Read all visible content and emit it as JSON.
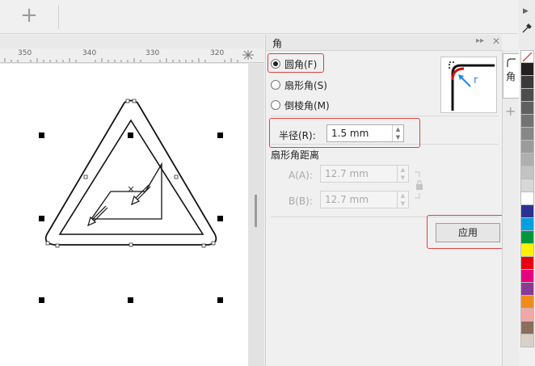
{
  "toolbar": {
    "add_glyph": "+"
  },
  "ruler": {
    "labels": [
      "350",
      "340",
      "330",
      "320"
    ]
  },
  "docker": {
    "title": "角",
    "options": [
      {
        "label": "圆角(F)",
        "checked": true
      },
      {
        "label": "扇形角(S)",
        "checked": false
      },
      {
        "label": "倒棱角(M)",
        "checked": false
      }
    ],
    "radius": {
      "label": "半径(R):",
      "value": "1.5 mm"
    },
    "group_title": "扇形角距离",
    "distance_a": {
      "label": "A(A):",
      "value": "12.7 mm"
    },
    "distance_b": {
      "label": "B(B):",
      "value": "12.7 mm"
    },
    "apply_label": "应用",
    "preview_label": "r"
  },
  "tabstrip": {
    "tab_label": "角"
  },
  "palette": {
    "colors": [
      "#ffffff",
      "#231f20",
      "#3a3a3a",
      "#4d4d4d",
      "#606060",
      "#737373",
      "#878787",
      "#9b9b9b",
      "#afafaf",
      "#c3c3c3",
      "#d7d7d7",
      "#ffffff",
      "#2e3192",
      "#00a0e0",
      "#00963e",
      "#fff200",
      "#e60012",
      "#e4007f",
      "#8b3a95",
      "#f08b1d",
      "#f2a7a7",
      "#8c6e5f",
      "#d9d0c9"
    ],
    "accent": "#e04040"
  }
}
